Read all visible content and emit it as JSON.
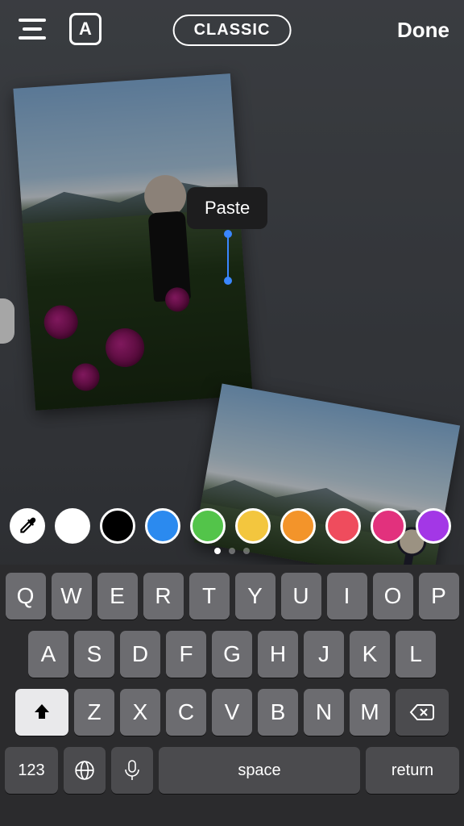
{
  "toolbar": {
    "style_label": "CLASSIC",
    "done_label": "Done"
  },
  "context_menu": {
    "paste_label": "Paste"
  },
  "palette": {
    "colors": [
      "#ffffff",
      "#000000",
      "#2b8aef",
      "#53c44a",
      "#f3c63e",
      "#f3942a",
      "#ef4c5d",
      "#e2317d",
      "#a337e6"
    ],
    "page_dots": 3,
    "active_dot": 0
  },
  "keyboard": {
    "row1": [
      "Q",
      "W",
      "E",
      "R",
      "T",
      "Y",
      "U",
      "I",
      "O",
      "P"
    ],
    "row2": [
      "A",
      "S",
      "D",
      "F",
      "G",
      "H",
      "J",
      "K",
      "L"
    ],
    "row3": [
      "Z",
      "X",
      "C",
      "V",
      "B",
      "N",
      "M"
    ],
    "numbers_label": "123",
    "space_label": "space",
    "return_label": "return"
  }
}
